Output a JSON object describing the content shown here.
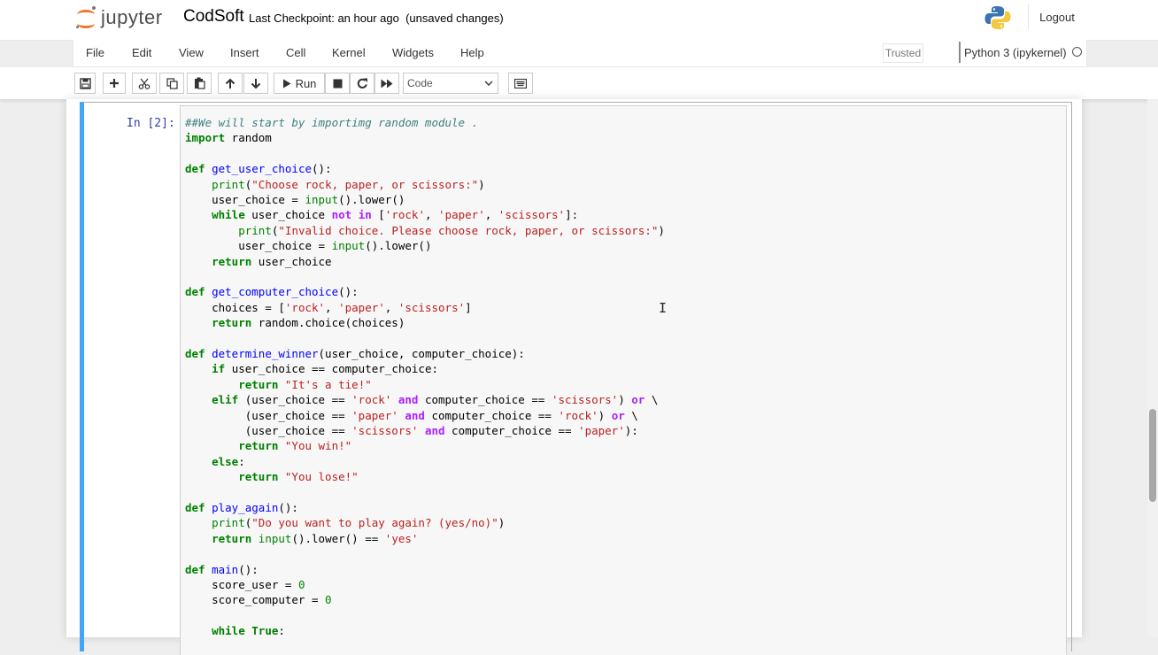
{
  "header": {
    "logo_text": "jupyter",
    "notebook_name": "CodSoft",
    "checkpoint_text": "Last Checkpoint: an hour ago",
    "unsaved_text": "(unsaved changes)",
    "logout_label": "Logout"
  },
  "menubar": {
    "items": [
      "File",
      "Edit",
      "View",
      "Insert",
      "Cell",
      "Kernel",
      "Widgets",
      "Help"
    ],
    "trusted_label": "Trusted",
    "kernel_name": "Python 3 (ipykernel)"
  },
  "toolbar": {
    "run_label": "Run",
    "cell_type": "Code",
    "icons": [
      "save-icon",
      "plus-icon",
      "cut-icon",
      "copy-icon",
      "paste-icon",
      "arrow-up-icon",
      "arrow-down-icon",
      "run-icon",
      "stop-icon",
      "restart-icon",
      "fast-forward-icon",
      "keyboard-icon"
    ]
  },
  "cell": {
    "prompt": "In [2]:",
    "lines": [
      "##We will start by importimg random module .",
      "import random",
      "",
      "def get_user_choice():",
      "    print(\"Choose rock, paper, or scissors:\")",
      "    user_choice = input().lower()",
      "    while user_choice not in ['rock', 'paper', 'scissors']:",
      "        print(\"Invalid choice. Please choose rock, paper, or scissors:\")",
      "        user_choice = input().lower()",
      "    return user_choice",
      "",
      "def get_computer_choice():",
      "    choices = ['rock', 'paper', 'scissors']",
      "    return random.choice(choices)",
      "",
      "def determine_winner(user_choice, computer_choice):",
      "    if user_choice == computer_choice:",
      "        return \"It's a tie!\"",
      "    elif (user_choice == 'rock' and computer_choice == 'scissors') or \\",
      "         (user_choice == 'paper' and computer_choice == 'rock') or \\",
      "         (user_choice == 'scissors' and computer_choice == 'paper'):",
      "        return \"You win!\"",
      "    else:",
      "        return \"You lose!\"",
      "",
      "def play_again():",
      "    print(\"Do you want to play again? (yes/no)\")",
      "    return input().lower() == 'yes'",
      "",
      "def main():",
      "    score_user = 0",
      "    score_computer = 0",
      "",
      "    while True:"
    ]
  },
  "colors": {
    "cell_border_active": "#42a5f5",
    "logo_orange": "#f37726",
    "prompt_blue": "#303f9f"
  }
}
